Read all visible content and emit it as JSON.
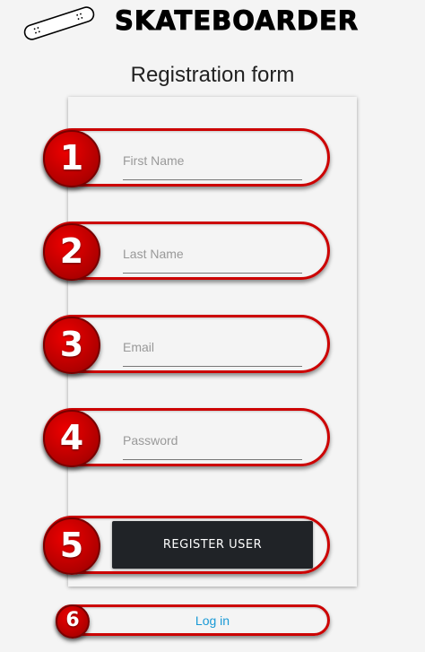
{
  "header": {
    "brand": "SKATEBOARDER",
    "logo_icon": "skateboard-icon"
  },
  "form": {
    "title": "Registration form",
    "fields": [
      {
        "placeholder": "First Name"
      },
      {
        "placeholder": "Last Name"
      },
      {
        "placeholder": "Email"
      },
      {
        "placeholder": "Password"
      }
    ],
    "register_label": "REGISTER USER",
    "login_label": "Log in"
  },
  "annotations": {
    "numbers": [
      "1",
      "2",
      "3",
      "4",
      "5",
      "6"
    ],
    "color": "#cc0000"
  }
}
